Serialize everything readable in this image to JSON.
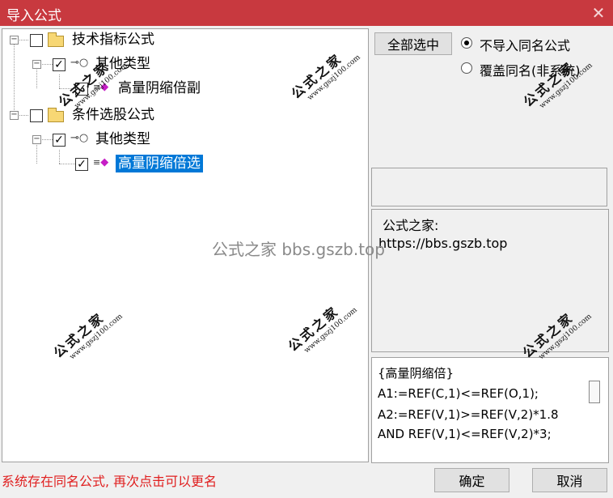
{
  "window": {
    "title": "导入公式",
    "close_glyph": "✕"
  },
  "tree": {
    "nodes": [
      {
        "label": "技术指标公式",
        "checked": false
      },
      {
        "label": "其他类型",
        "checked": true
      },
      {
        "label": "高量阴缩倍副",
        "checked": true
      },
      {
        "label": "条件选股公式",
        "checked": false
      },
      {
        "label": "其他类型",
        "checked": true
      },
      {
        "label": "高量阴缩倍选",
        "checked": true,
        "selected": true
      }
    ],
    "check_glyph": "✓",
    "expander_glyph": "−"
  },
  "options": {
    "select_all_label": "全部选中",
    "radio_no_import": "不导入同名公式",
    "radio_overwrite": "覆盖同名(非系统)",
    "selected_radio": "no_import"
  },
  "info": {
    "line1": "公式之家:",
    "line2": "https://bbs.gszb.top"
  },
  "code": {
    "lines": [
      "{高量阴缩倍}",
      "A1:=REF(C,1)<=REF(O,1);",
      "A2:=REF(V,1)>=REF(V,2)*1.8",
      "AND REF(V,1)<=REF(V,2)*3;"
    ]
  },
  "status_text": "系统存在同名公式, 再次点击可以更名",
  "buttons": {
    "ok": "确定",
    "cancel": "取消"
  },
  "watermarks": {
    "title": "公式之家",
    "url": "www.gszj100.com",
    "center": "公式之家 bbs.gszb.top"
  },
  "colors": {
    "titlebar": "#c8393f",
    "selection": "#0078d7",
    "status_text": "#e02020",
    "gem_icon": "#c61ec6"
  }
}
